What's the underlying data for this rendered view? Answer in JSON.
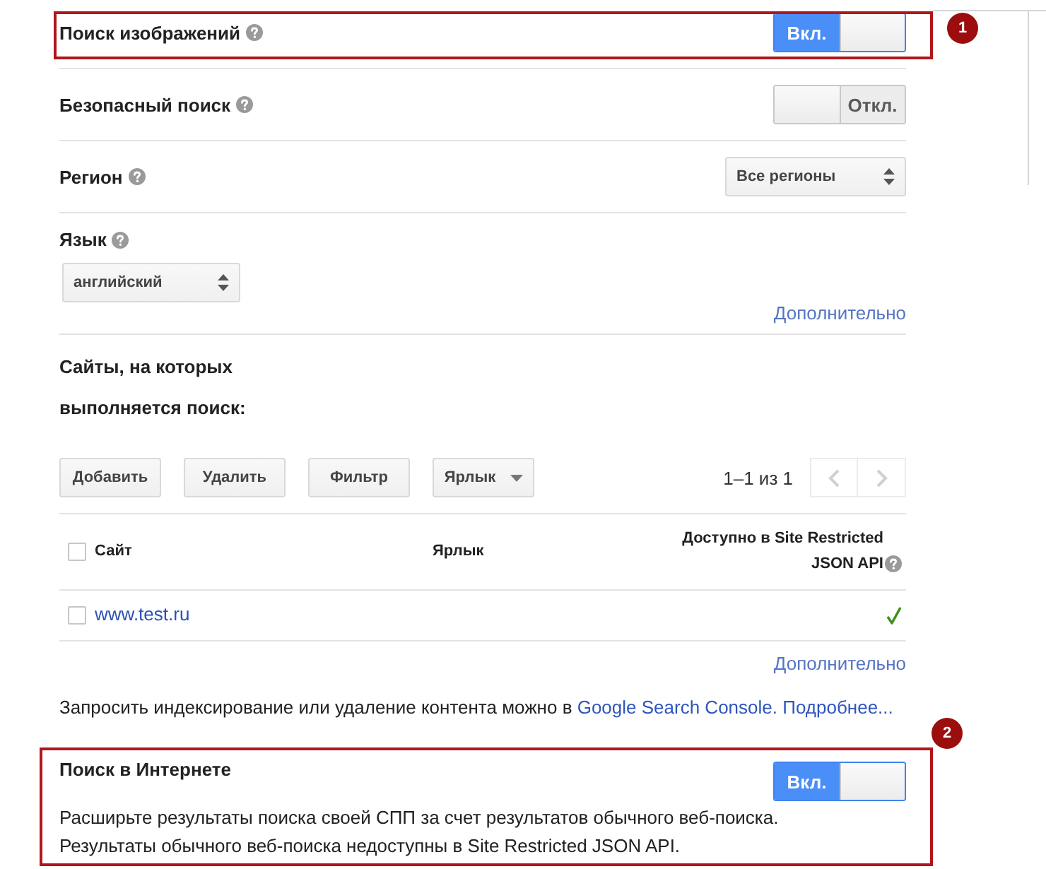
{
  "settings": [
    {
      "kind": "toggle",
      "label": "Поиск изображений",
      "help": true,
      "toggle": {
        "on": true,
        "label": "Вкл."
      },
      "annotation": {
        "number": "1"
      }
    },
    {
      "kind": "toggle",
      "label": "Безопасный поиск",
      "help": true,
      "toggle": {
        "on": false,
        "label": "Откл."
      }
    },
    {
      "kind": "select",
      "label": "Регион",
      "help": true,
      "select": {
        "value": "Все регионы"
      }
    },
    {
      "kind": "select_below",
      "label": "Язык",
      "help": true,
      "select": {
        "value": "английский"
      },
      "link": "Дополнительно"
    }
  ],
  "sites": {
    "title": "Сайты, на которых выполняется поиск:",
    "toolbar": [
      {
        "kind": "button",
        "label": "Добавить"
      },
      {
        "kind": "button",
        "label": "Удалить"
      },
      {
        "kind": "button",
        "label": "Фильтр"
      },
      {
        "kind": "menu",
        "label": "Ярлык"
      }
    ],
    "pager": {
      "range": "1–1 из 1",
      "buttons": [
        {
          "kind": "prev",
          "disabled": true
        },
        {
          "kind": "next",
          "disabled": true
        }
      ]
    },
    "table": {
      "select_all": {
        "checked": false
      },
      "columns": [
        {
          "label": "Сайт"
        },
        {
          "label": "Ярлык"
        },
        {
          "label": "Доступно в Site Restricted JSON API",
          "help": true
        }
      ],
      "rows": [
        {
          "checked": false,
          "site": "www.test.ru",
          "api_available": true
        }
      ]
    },
    "more_link": "Дополнительно"
  },
  "notice": {
    "text": "Запросить индексирование или удаление контента можно в",
    "links": [
      "Google Search Console.",
      "Подробнее..."
    ]
  },
  "web_search": {
    "title": "Поиск в Интернете",
    "toggle": {
      "on": true,
      "label": "Вкл."
    },
    "description": [
      "Расширьте результаты поиска своей СПП за счет результатов обычного веб-поиска.",
      "Результаты обычного веб-поиска недоступны в Site Restricted JSON API."
    ],
    "annotation": {
      "number": "2"
    }
  }
}
